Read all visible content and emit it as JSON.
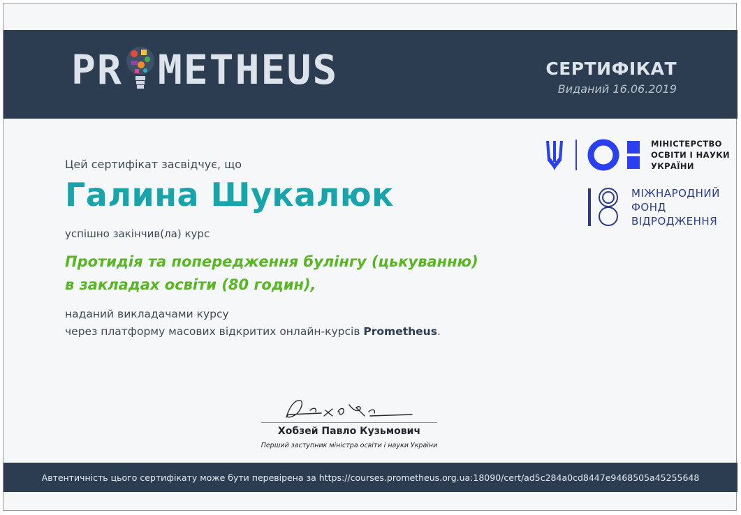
{
  "header": {
    "logo_text_left": "PR",
    "logo_text_right": "METHEUS",
    "title": "СЕРТИФІКАТ",
    "issued": "Виданий 16.06.2019"
  },
  "partners": {
    "ministry_lines": [
      "МІНІСТЕРСТВО",
      "ОСВІТИ І НАУКИ",
      "УКРАЇНИ"
    ],
    "foundation_lines": [
      "МІЖНАРОДНИЙ",
      "ФОНД",
      "ВІДРОДЖЕННЯ"
    ]
  },
  "certificate": {
    "intro": "Цей сертифікат засвідчує, що",
    "recipient": "Галина Шукалюк",
    "completed": "успішно закінчив(ла) курс",
    "course_line1": "Протидія та попередження булінгу (цькуванню)",
    "course_line2": "в закладах освіти (80 годин),",
    "provided_line1": "наданий викладачами курсу",
    "provided_line2_prefix": "через платформу масових відкритих онлайн-курсів ",
    "platform": "Prometheus",
    "provided_line2_suffix": "."
  },
  "signatory": {
    "name": "Хобзей Павло Кузьмович",
    "role": "Перший заступник міністра освіти і науки України"
  },
  "footer": {
    "verification": "Автентичність цього сертифікату може бути перевірена за https://courses.prometheus.org.ua:18090/cert/ad5c284a0cd8447e9468505a45255648"
  },
  "colors": {
    "header_bg": "#2c3d52",
    "name": "#17a4ab",
    "course": "#57b622",
    "ministry_blue": "#2a3ff0",
    "foundation_blue": "#2b3a8c"
  }
}
